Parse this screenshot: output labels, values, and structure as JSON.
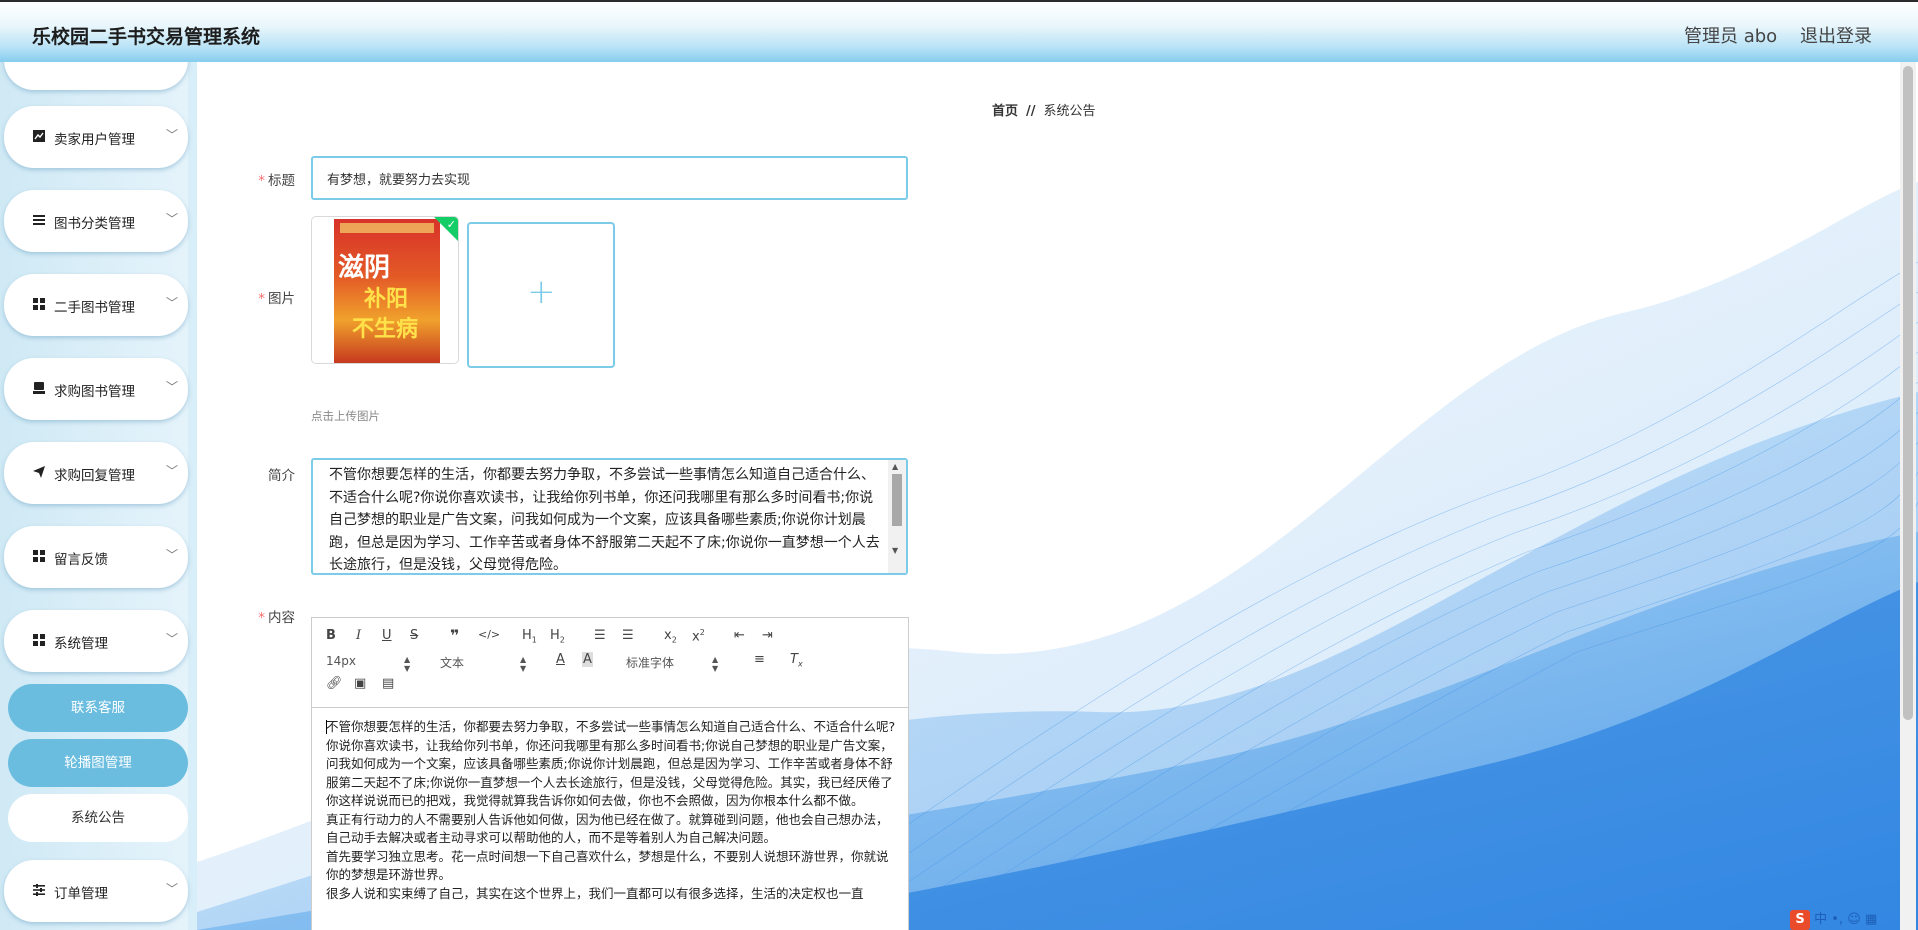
{
  "header": {
    "title": "乐校园二手书交易管理系统",
    "admin_label": "管理员 abo",
    "logout_label": "退出登录"
  },
  "sidebar": {
    "menus": [
      {
        "label": "卖家用户管理",
        "icon": "chart-icon"
      },
      {
        "label": "图书分类管理",
        "icon": "list-icon"
      },
      {
        "label": "二手图书管理",
        "icon": "grid-icon"
      },
      {
        "label": "求购图书管理",
        "icon": "printer-icon"
      },
      {
        "label": "求购回复管理",
        "icon": "send-icon"
      },
      {
        "label": "留言反馈",
        "icon": "grid-icon"
      },
      {
        "label": "系统管理",
        "icon": "grid-icon"
      },
      {
        "label": "订单管理",
        "icon": "sliders-icon"
      }
    ],
    "submenus": [
      {
        "label": "联系客服"
      },
      {
        "label": "轮播图管理"
      },
      {
        "label": "系统公告"
      }
    ]
  },
  "breadcrumb": {
    "home": "首页",
    "separator": "//",
    "current": "系统公告"
  },
  "form": {
    "title_label": "标题",
    "title_value": "有梦想，就要努力去实现",
    "image_label": "图片",
    "upload_hint": "点击上传图片",
    "cover_text": [
      "滋阴",
      "补阳",
      "不生病"
    ],
    "intro_label": "简介",
    "intro_value": "不管你想要怎样的生活，你都要去努力争取，不多尝试一些事情怎么知道自己适合什么、不适合什么呢?你说你喜欢读书，让我给你列书单，你还问我哪里有那么多时间看书;你说自己梦想的职业是广告文案，问我如何成为一个文案，应该具备哪些素质;你说你计划晨跑，但总是因为学习、工作辛苦或者身体不舒服第二天起不了床;你说你一直梦想一个人去长途旅行，但是没钱，父母觉得危险。",
    "content_label": "内容",
    "editor": {
      "font_size": "14px",
      "block_type": "文本",
      "font_family": "标准字体",
      "toolbar_icons": [
        "bold-icon",
        "italic-icon",
        "underline-icon",
        "strike-icon",
        "quote-icon",
        "code-icon",
        "h1-icon",
        "h2-icon",
        "ordered-list-icon",
        "bullet-list-icon",
        "subscript-icon",
        "superscript-icon",
        "outdent-icon",
        "indent-icon",
        "font-color-icon",
        "background-color-icon",
        "align-icon",
        "clear-format-icon",
        "link-icon",
        "image-icon",
        "video-icon"
      ],
      "paragraphs": [
        "不管你想要怎样的生活，你都要去努力争取，不多尝试一些事情怎么知道自己适合什么、不适合什么呢?",
        "你说你喜欢读书，让我给你列书单，你还问我哪里有那么多时间看书;你说自己梦想的职业是广告文案，问我如何成为一个文案，应该具备哪些素质;你说你计划晨跑，但总是因为学习、工作辛苦或者身体不舒服第二天起不了床;你说你一直梦想一个人去长途旅行，但是没钱，父母觉得危险。其实，我已经厌倦了你这样说说而已的把戏，我觉得就算我告诉你如何去做，你也不会照做，因为你根本什么都不做。",
        "真正有行动力的人不需要别人告诉他如何做，因为他已经在做了。就算碰到问题，他也会自己想办法，自己动手去解决或者主动寻求可以帮助他的人，而不是等着别人为自己解决问题。",
        "首先要学习独立思考。花一点时间想一下自己喜欢什么，梦想是什么，不要别人说想环游世界，你就说你的梦想是环游世界。",
        "很多人说和实束缚了自己，其实在这个世界上，我们一直都可以有很多选择，生活的决定权也一直"
      ]
    }
  },
  "ime": {
    "label": "中"
  }
}
